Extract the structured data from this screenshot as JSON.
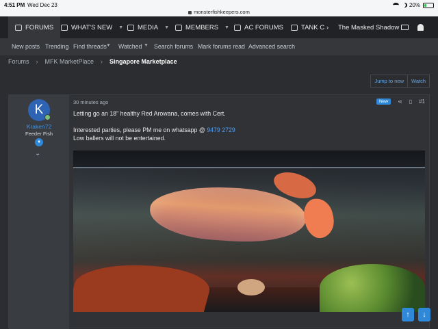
{
  "status_bar": {
    "time": "4:51 PM",
    "date": "Wed Dec 23",
    "url": "monsterfishkeepers.com",
    "battery": "20%",
    "battery_level": 0.2
  },
  "nav": {
    "items": [
      {
        "label": "FORUMS",
        "icon": "forums-icon"
      },
      {
        "label": "WHAT'S NEW",
        "icon": "whats-new-icon"
      },
      {
        "label": "MEDIA",
        "icon": "media-icon"
      },
      {
        "label": "MEMBERS",
        "icon": "members-icon"
      },
      {
        "label": "AC FORUMS",
        "icon": "folder-icon"
      },
      {
        "label": "TANK C",
        "icon": "folder-icon"
      }
    ],
    "user": "The Masked Shadow"
  },
  "subnav": [
    "New posts",
    "Trending",
    "Find threads",
    "Watched",
    "Search forums",
    "Mark forums read",
    "Advanced search"
  ],
  "breadcrumbs": [
    "Forums",
    "MFK MarketPlace",
    "Singapore Marketplace"
  ],
  "thread_actions": {
    "jump": "Jump to new",
    "watch": "Watch"
  },
  "post": {
    "timestamp": "30 minutes ago",
    "new_label": "New",
    "number": "#1",
    "author": {
      "initial": "K",
      "name": "Kraken72",
      "title": "Feeder Fish"
    },
    "line1": "Letting go an 18\" healthy Red Arowana, comes with Cert.",
    "line2": "Interested parties, please PM me on whatsapp @ ",
    "phone": "9479 2729",
    "line3": "Low ballers will not be entertained."
  },
  "colors": {
    "accent": "#2f88d8",
    "link": "#4da3ff",
    "background": "#2b2d30"
  }
}
